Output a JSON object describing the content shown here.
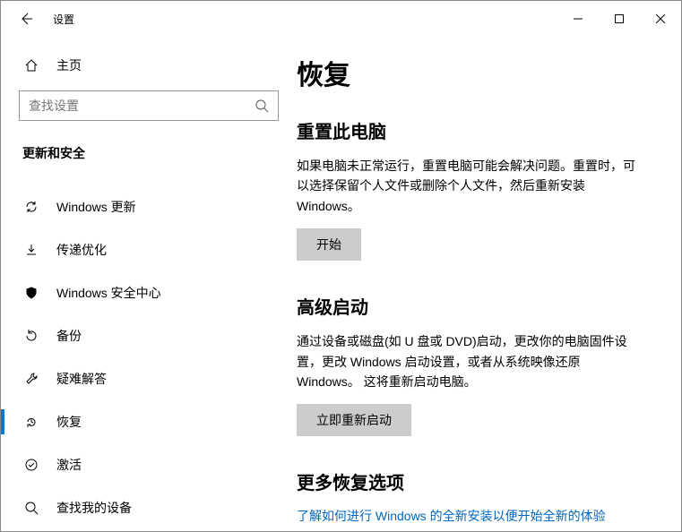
{
  "window": {
    "title": "设置"
  },
  "sidebar": {
    "home": "主页",
    "search_placeholder": "查找设置",
    "category": "更新和安全",
    "items": [
      {
        "label": "Windows 更新"
      },
      {
        "label": "传递优化"
      },
      {
        "label": "Windows 安全中心"
      },
      {
        "label": "备份"
      },
      {
        "label": "疑难解答"
      },
      {
        "label": "恢复"
      },
      {
        "label": "激活"
      },
      {
        "label": "查找我的设备"
      }
    ]
  },
  "content": {
    "heading": "恢复",
    "reset": {
      "title": "重置此电脑",
      "text": "如果电脑未正常运行，重置电脑可能会解决问题。重置时，可以选择保留个人文件或删除个人文件，然后重新安装 Windows。",
      "button": "开始"
    },
    "advanced": {
      "title": "高级启动",
      "text": "通过设备或磁盘(如 U 盘或 DVD)启动，更改你的电脑固件设置，更改 Windows 启动设置，或者从系统映像还原 Windows。 这将重新启动电脑。",
      "button": "立即重新启动"
    },
    "more": {
      "title": "更多恢复选项",
      "link": "了解如何进行 Windows 的全新安装以便开始全新的体验"
    }
  }
}
